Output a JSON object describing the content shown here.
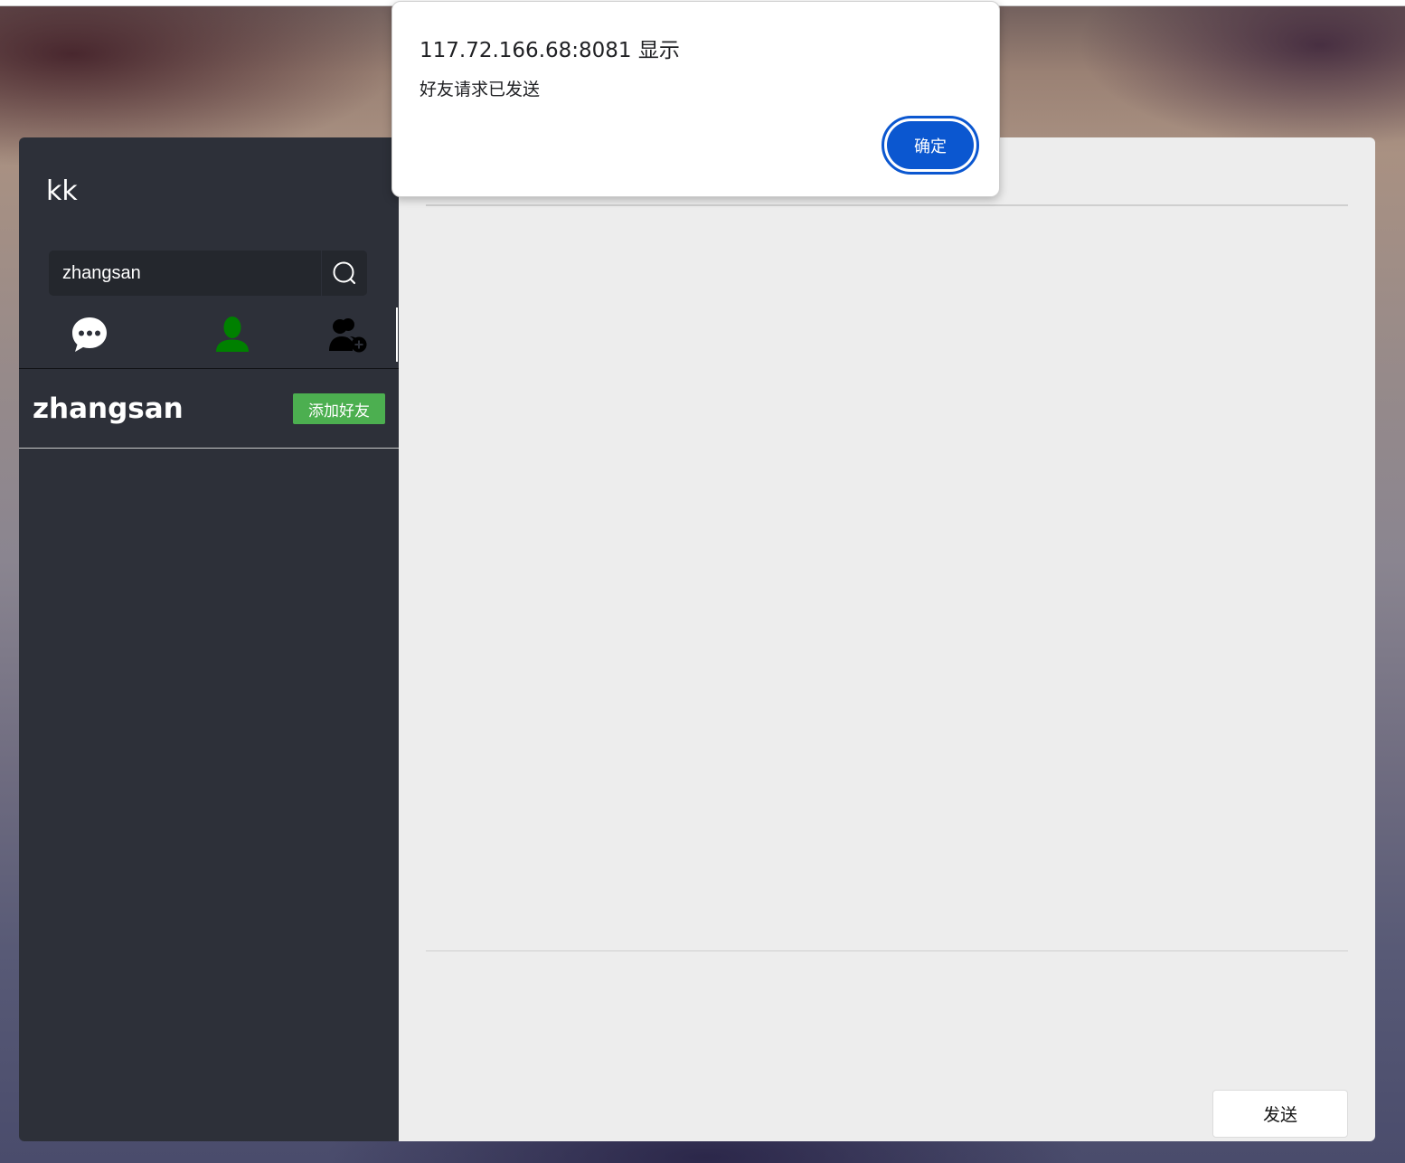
{
  "dialog": {
    "title": "117.72.166.68:8081 显示",
    "message": "好友请求已发送",
    "ok_label": "确定",
    "accent_color": "#0b57d0"
  },
  "sidebar": {
    "username": "kk",
    "search": {
      "value": "zhangsan",
      "icon": "search-icon"
    },
    "tabs": [
      {
        "name": "chat",
        "icon": "chat-bubble-icon",
        "color": "#ffffff",
        "active": false
      },
      {
        "name": "contacts",
        "icon": "user-icon",
        "color": "#008000",
        "active": true
      },
      {
        "name": "add-friend",
        "icon": "user-add-icon",
        "color": "#000000",
        "active": false
      }
    ],
    "results": [
      {
        "name": "zhangsan",
        "action_label": "添加好友",
        "action_color": "#4caf50"
      }
    ]
  },
  "main": {
    "send_label": "发送"
  }
}
